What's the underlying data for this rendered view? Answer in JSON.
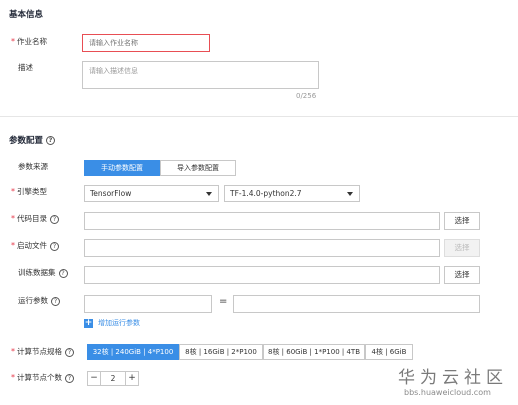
{
  "basic": {
    "title": "基本信息",
    "job_name_label": "作业名称",
    "job_name_placeholder": "请输入作业名称",
    "desc_label": "描述",
    "desc_placeholder": "请输入描述信息",
    "desc_counter": "0/256"
  },
  "params": {
    "title": "参数配置",
    "source_label": "参数来源",
    "source_tabs": [
      "手动参数配置",
      "导入参数配置"
    ],
    "engine_label": "引擎类型",
    "engine_value": "TensorFlow",
    "engine_version": "TF-1.4.0-python2.7",
    "code_dir_label": "代码目录",
    "startup_label": "启动文件",
    "dataset_label": "训练数据集",
    "run_params_label": "运行参数",
    "select_button": "选择",
    "equals": "=",
    "add_param_link": "增加运行参数",
    "spec_label": "计算节点规格",
    "specs": [
      "32核 | 240GiB | 4*P100",
      "8核 | 16GiB | 2*P100",
      "8核 | 60GiB | 1*P100 | 4TB",
      "4核 | 6GiB"
    ],
    "count_label": "计算节点个数",
    "count_minus": "−",
    "count_value": "2",
    "count_plus": "+"
  },
  "watermark": {
    "title": "华为云社区",
    "url": "bbs.huaweicloud.com"
  }
}
